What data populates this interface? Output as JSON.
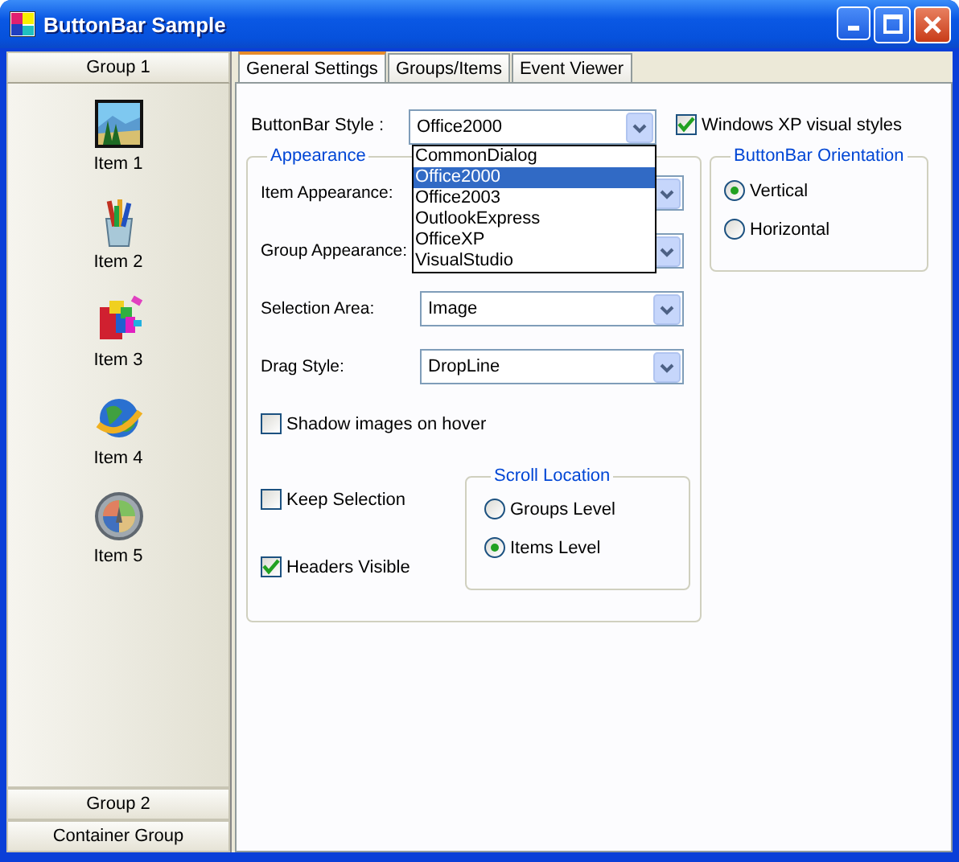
{
  "window": {
    "title": "ButtonBar Sample"
  },
  "sidebar": {
    "groups": [
      {
        "label": "Group 1",
        "expanded": true,
        "items": [
          {
            "label": "Item 1"
          },
          {
            "label": "Item 2"
          },
          {
            "label": "Item 3"
          },
          {
            "label": "Item 4"
          },
          {
            "label": "Item 5"
          }
        ]
      },
      {
        "label": "Group 2",
        "expanded": false
      },
      {
        "label": "Container Group",
        "expanded": false
      }
    ]
  },
  "tabs": [
    {
      "label": "General Settings",
      "selected": true
    },
    {
      "label": "Groups/Items",
      "selected": false
    },
    {
      "label": "Event Viewer",
      "selected": false
    }
  ],
  "style_field": {
    "label": "ButtonBar Style :",
    "value": "Office2000",
    "expanded": true,
    "options": [
      {
        "label": "CommonDialog",
        "selected": false
      },
      {
        "label": "Office2000",
        "selected": true
      },
      {
        "label": "Office2003",
        "selected": false
      },
      {
        "label": "OutlookExpress",
        "selected": false
      },
      {
        "label": "OfficeXP",
        "selected": false
      },
      {
        "label": "VisualStudio",
        "selected": false
      }
    ]
  },
  "xp_styles": {
    "label": "Windows XP visual styles",
    "checked": true
  },
  "appearance": {
    "title": "Appearance",
    "fields": [
      {
        "label": "Item Appearance:"
      },
      {
        "label": "Group Appearance:"
      },
      {
        "label": "Selection Area:",
        "value": "Image"
      },
      {
        "label": "Drag Style:",
        "value": "DropLine"
      }
    ],
    "checkboxes": [
      {
        "label": "Shadow images on hover",
        "checked": false
      },
      {
        "label": "Keep Selection",
        "checked": false
      },
      {
        "label": "Headers Visible",
        "checked": true
      }
    ],
    "scroll_location": {
      "title": "Scroll Location",
      "options": [
        {
          "label": "Groups Level",
          "selected": false
        },
        {
          "label": "Items Level",
          "selected": true
        }
      ]
    }
  },
  "orientation": {
    "title": "ButtonBar Orientation",
    "options": [
      {
        "label": "Vertical",
        "selected": true
      },
      {
        "label": "Horizontal",
        "selected": false
      }
    ]
  }
}
